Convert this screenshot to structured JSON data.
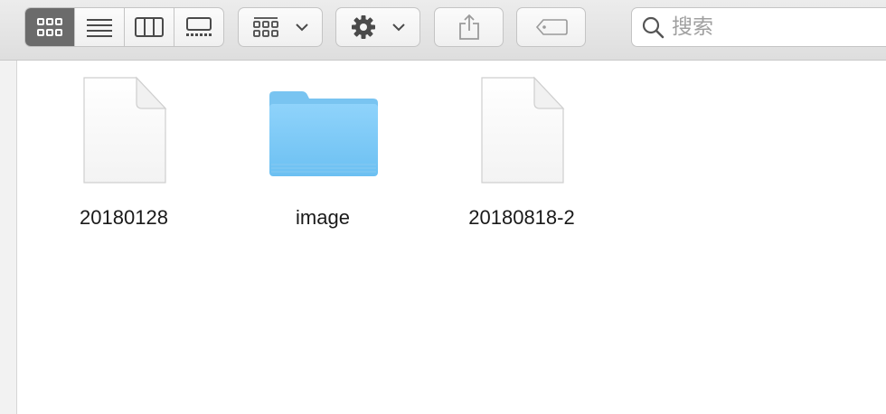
{
  "toolbar": {
    "view_modes": [
      {
        "name": "icon-view",
        "active": true
      },
      {
        "name": "list-view",
        "active": false
      },
      {
        "name": "column-view",
        "active": false
      },
      {
        "name": "gallery-view",
        "active": false
      }
    ],
    "search": {
      "placeholder": "搜索",
      "value": ""
    }
  },
  "icons": {
    "icon_view": "grid-icon",
    "list_view": "list-icon",
    "column_view": "columns-icon",
    "gallery_view": "gallery-icon",
    "arrange": "arrange-grid-icon",
    "action": "gear-icon",
    "share": "share-icon",
    "tag": "tag-icon",
    "search": "search-icon"
  },
  "colors": {
    "active_segment": "#6b6b6b",
    "folder_blue": "#6cc0f2",
    "toolbar_bg": "#e4e4e4"
  },
  "files": [
    {
      "name": "20180128",
      "kind": "document"
    },
    {
      "name": "image",
      "kind": "folder"
    },
    {
      "name": "20180818-2",
      "kind": "document"
    }
  ]
}
